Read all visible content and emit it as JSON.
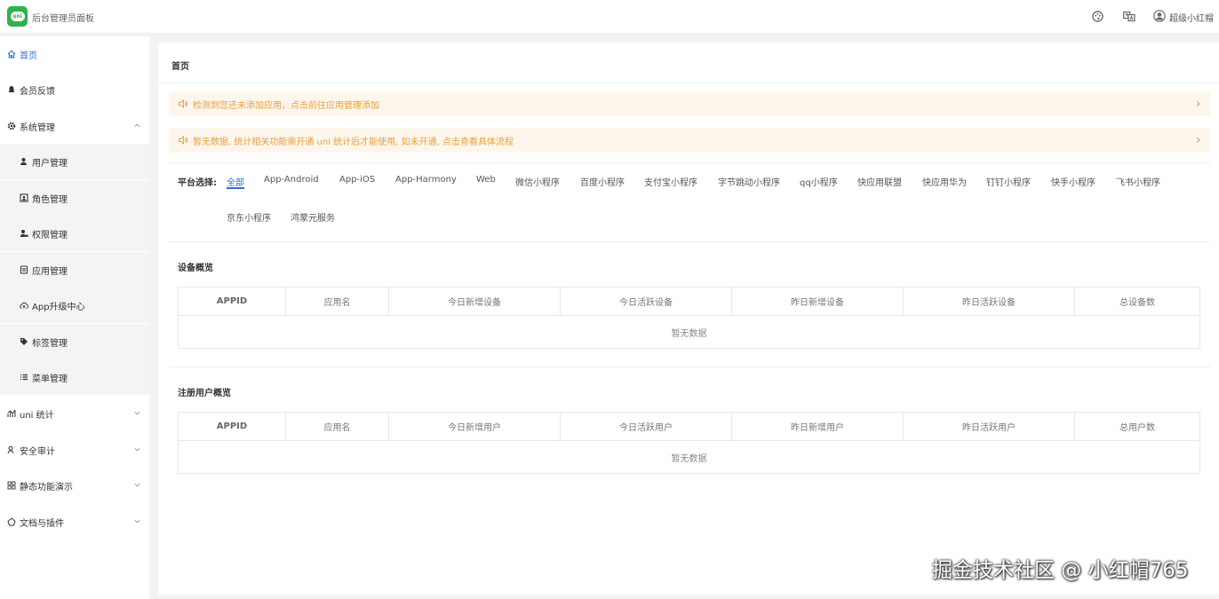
{
  "header": {
    "logo_text": "uni",
    "app_title": "后台管理员面板",
    "theme_icon": "palette-icon",
    "lang_icon": "translate-icon",
    "user_icon": "user-avatar-icon",
    "user_name": "超级小红帽"
  },
  "sidebar": {
    "items": [
      {
        "label": "首页",
        "icon": "home-icon",
        "active": true
      },
      {
        "label": "会员反馈",
        "icon": "feedback-icon"
      },
      {
        "label": "系统管理",
        "icon": "gear-icon",
        "expanded": true
      },
      {
        "label": "用户管理",
        "icon": "user-icon",
        "sub": true
      },
      {
        "label": "角色管理",
        "icon": "role-icon",
        "sub": true
      },
      {
        "label": "权限管理",
        "icon": "permission-icon",
        "sub": true
      },
      {
        "label": "应用管理",
        "icon": "app-icon",
        "sub": true
      },
      {
        "label": "App升级中心",
        "icon": "cloud-upload-icon",
        "sub": true
      },
      {
        "label": "标签管理",
        "icon": "tag-icon",
        "sub": true
      },
      {
        "label": "菜单管理",
        "icon": "list-icon",
        "sub": true
      },
      {
        "label": "uni 统计",
        "icon": "stats-icon"
      },
      {
        "label": "安全审计",
        "icon": "audit-icon"
      },
      {
        "label": "静态功能演示",
        "icon": "grid-icon"
      },
      {
        "label": "文档与插件",
        "icon": "doc-icon"
      }
    ]
  },
  "main": {
    "page_title": "首页",
    "notices": [
      "检测到您还未添加应用，点击前往应用管理添加",
      "暂无数据, 统计相关功能需开通 uni 统计后才能使用, 如未开通, 点击查看具体流程"
    ],
    "platform": {
      "label": "平台选择:",
      "selected": "全部",
      "options": [
        "全部",
        "App-Android",
        "App-iOS",
        "App-Harmony",
        "Web",
        "微信小程序",
        "百度小程序",
        "支付宝小程序",
        "字节跳动小程序",
        "qq小程序",
        "快应用联盟",
        "快应用华为",
        "钉钉小程序",
        "快手小程序",
        "飞书小程序",
        "京东小程序",
        "鸿蒙元服务"
      ]
    },
    "device_section": {
      "title": "设备概览",
      "columns": [
        "APPID",
        "应用名",
        "今日新增设备",
        "今日活跃设备",
        "昨日新增设备",
        "昨日活跃设备",
        "总设备数"
      ],
      "empty_text": "暂无数据"
    },
    "user_section": {
      "title": "注册用户概览",
      "columns": [
        "APPID",
        "应用名",
        "今日新增用户",
        "今日活跃用户",
        "昨日新增用户",
        "昨日活跃用户",
        "总用户数"
      ],
      "empty_text": "暂无数据"
    }
  },
  "watermark": "掘金技术社区 @ 小红帽765",
  "colors": {
    "accent": "#2d6fd6",
    "notice_bg": "#fdf6ec",
    "notice_text": "#e6a23c",
    "brand": "#2fb24a"
  }
}
